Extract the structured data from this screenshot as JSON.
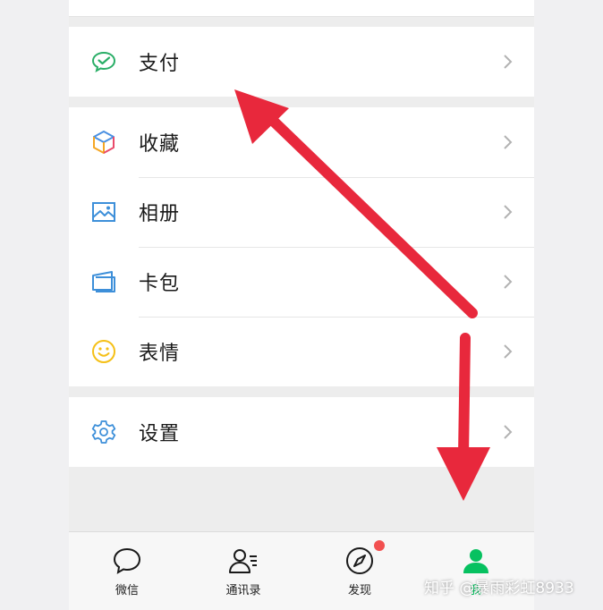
{
  "menu": {
    "pay": {
      "label": "支付",
      "icon": "wechat-pay-icon"
    },
    "favorites": {
      "label": "收藏",
      "icon": "cube-icon"
    },
    "album": {
      "label": "相册",
      "icon": "image-icon"
    },
    "cards": {
      "label": "卡包",
      "icon": "card-icon"
    },
    "stickers": {
      "label": "表情",
      "icon": "smile-icon"
    },
    "settings": {
      "label": "设置",
      "icon": "gear-icon"
    }
  },
  "tabs": [
    {
      "label": "微信",
      "icon": "chat-bubble-icon"
    },
    {
      "label": "通讯录",
      "icon": "contacts-icon"
    },
    {
      "label": "发现",
      "icon": "compass-icon",
      "badge": true
    },
    {
      "label": "我",
      "icon": "person-icon",
      "active": true
    }
  ],
  "colors": {
    "accent": "#07c160",
    "arrow": "#e8283c",
    "badge": "#f25050"
  },
  "watermark": "知乎 @暴雨彩虹8933"
}
